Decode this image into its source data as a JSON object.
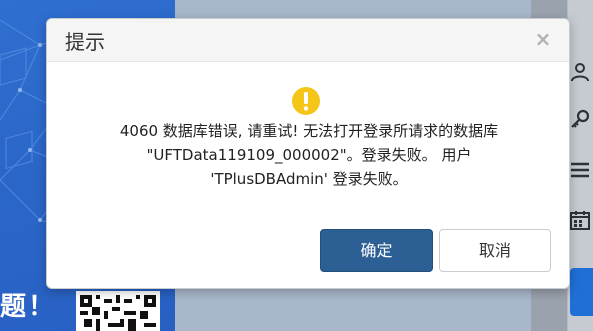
{
  "background": {
    "slogan": "题！"
  },
  "dialog": {
    "title": "提示",
    "close_glyph": "×",
    "message_lines": [
      "4060 数据库错误, 请重试! 无法打开登录所请求的数据库",
      "\"UFTData119109_000002\"。登录失败。 用户",
      "'TPlusDBAdmin' 登录失败。"
    ],
    "ok_label": "确定",
    "cancel_label": "取消",
    "icon": "warning-icon"
  },
  "colors": {
    "primary_button": "#2c5f93",
    "warning": "#f5c518",
    "left_panel": "#2f6fd0",
    "side_button": "#1f6fd6"
  }
}
